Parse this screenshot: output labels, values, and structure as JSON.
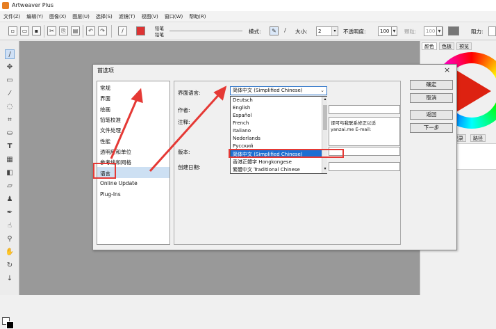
{
  "app": {
    "title": "Artweaver Plus"
  },
  "menubar": {
    "items": [
      "文件(Z)",
      "编辑(Y)",
      "图像(X)",
      "图层(U)",
      "选择(S)",
      "滤镜(T)",
      "视图(V)",
      "窗口(W)",
      "帮助(R)"
    ]
  },
  "toolbar": {
    "brush_label_1": "铅笔",
    "brush_label_2": "铅笔",
    "mode_label": "模式:",
    "size_label": "大小:",
    "size_value": "2",
    "opacity_label": "不透明度:",
    "opacity_value": "100",
    "pressure_label": "颗粒:",
    "pressure_value": "100",
    "resistance_label": "阻力:"
  },
  "right_panel": {
    "tabs": [
      "颜色",
      "色板",
      "预览"
    ],
    "bottom_tabs": [
      "记录",
      "路径"
    ]
  },
  "dialog": {
    "title": "首选项",
    "close": "×",
    "categories": [
      "常规",
      "界面",
      "绘画",
      "铅笔校准",
      "文件处理",
      "性能",
      "透明度和单位",
      "参考线和网格",
      "语言",
      "Online Update",
      "Plug-Ins"
    ],
    "selected_category": "语言",
    "labels": {
      "ui_language": "界面语言:",
      "author": "作者:",
      "note": "注释:",
      "version": "版本:",
      "created": "创建日期:"
    },
    "note_text_1": "译可与我联系修正以适",
    "note_text_2": "yanzai.me E-mail:",
    "language_combo": "简体中文 (Simplified Chinese)",
    "language_options": [
      "Deutsch",
      "English",
      "Español",
      "French",
      "Italiano",
      "Nederlands",
      "Русский",
      "简体中文 (Simplified Chinese)",
      "香港正體字 Hongkongese",
      "繁體中文 Traditional Chinese"
    ],
    "selected_option": "简体中文 (Simplified Chinese)",
    "buttons": {
      "ok": "确定",
      "cancel": "取消",
      "back": "返回",
      "next": "下一步"
    }
  },
  "colors": {
    "annotation": "#e53935",
    "selection": "#1c6fd3"
  }
}
